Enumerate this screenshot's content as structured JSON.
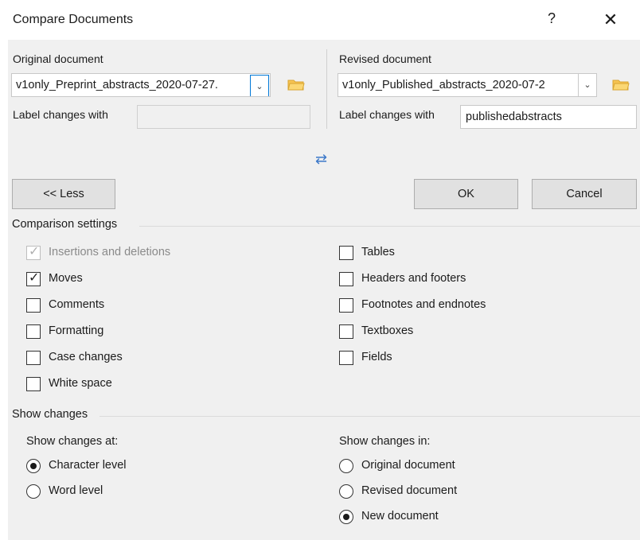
{
  "dialog": {
    "title": "Compare Documents",
    "help_label": "?",
    "close_label": "✕"
  },
  "original": {
    "heading": "Original document",
    "file": "v1only_Preprint_abstracts_2020-07-27.",
    "label_text": "Label changes with",
    "label_value": ""
  },
  "revised": {
    "heading": "Revised document",
    "file": "v1only_Published_abstracts_2020-07-2",
    "label_text": "Label changes with",
    "label_value": "publishedabstracts"
  },
  "swap_icon": "⇄",
  "buttons": {
    "less": "<< Less",
    "ok": "OK",
    "cancel": "Cancel"
  },
  "comparison": {
    "heading": "Comparison settings",
    "left": [
      {
        "label": "Insertions and deletions",
        "checked": true,
        "disabled": true
      },
      {
        "label": "Moves",
        "checked": true,
        "disabled": false
      },
      {
        "label": "Comments",
        "checked": false,
        "disabled": false
      },
      {
        "label": "Formatting",
        "checked": false,
        "disabled": false
      },
      {
        "label": "Case changes",
        "checked": false,
        "disabled": false
      },
      {
        "label": "White space",
        "checked": false,
        "disabled": false
      }
    ],
    "right": [
      {
        "label": "Tables",
        "checked": false
      },
      {
        "label": "Headers and footers",
        "checked": false
      },
      {
        "label": "Footnotes and endnotes",
        "checked": false
      },
      {
        "label": "Textboxes",
        "checked": false
      },
      {
        "label": "Fields",
        "checked": false
      }
    ]
  },
  "show_changes": {
    "heading": "Show changes",
    "at_heading": "Show changes at:",
    "at_options": [
      {
        "label": "Character level",
        "selected": true
      },
      {
        "label": "Word level",
        "selected": false
      }
    ],
    "in_heading": "Show changes in:",
    "in_options": [
      {
        "label": "Original document",
        "selected": false
      },
      {
        "label": "Revised document",
        "selected": false
      },
      {
        "label": "New document",
        "selected": true
      }
    ]
  },
  "icons": {
    "folder": "folder-icon",
    "chevron": "chevron-down-icon",
    "check": "checkmark-icon"
  }
}
